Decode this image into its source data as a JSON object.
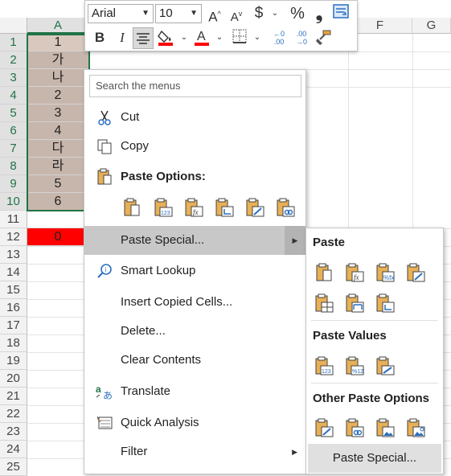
{
  "toolbar": {
    "font_name": "Arial",
    "font_size": "10",
    "grow_label": "A",
    "shrink_label": "A",
    "currency_label": "$",
    "percent_label": "%",
    "comma_label": "❟",
    "bold_label": "B",
    "italic_label": "I",
    "font_color_label": "A",
    "inc_decimal_label": "←0\n.00",
    "dec_decimal_label": ".00\n→0"
  },
  "columns": [
    "A",
    "F",
    "G"
  ],
  "rows": [
    "1",
    "2",
    "3",
    "4",
    "5",
    "6",
    "7",
    "8",
    "9",
    "10",
    "11",
    "12",
    "13",
    "14",
    "15",
    "16",
    "17",
    "18",
    "19",
    "20",
    "21",
    "22",
    "23",
    "24",
    "25"
  ],
  "cells": [
    "1",
    "가",
    "나",
    "2",
    "3",
    "4",
    "다",
    "라",
    "5",
    "6",
    "",
    "0"
  ],
  "colors": {
    "selection_fill": "#c7b6ac",
    "red_cell": "#ff0000",
    "excel_green": "#217346"
  },
  "menu": {
    "search_placeholder": "Search the menus",
    "cut": "Cut",
    "copy": "Copy",
    "paste_options": "Paste Options:",
    "paste_special": "Paste Special...",
    "smart_lookup": "Smart Lookup",
    "insert_copied_cells": "Insert Copied Cells...",
    "delete": "Delete...",
    "clear_contents": "Clear Contents",
    "translate": "Translate",
    "quick_analysis": "Quick Analysis",
    "filter": "Filter"
  },
  "submenu": {
    "paste": "Paste",
    "paste_values": "Paste Values",
    "other_paste_options": "Other Paste Options",
    "paste_special_button": "Paste Special..."
  }
}
